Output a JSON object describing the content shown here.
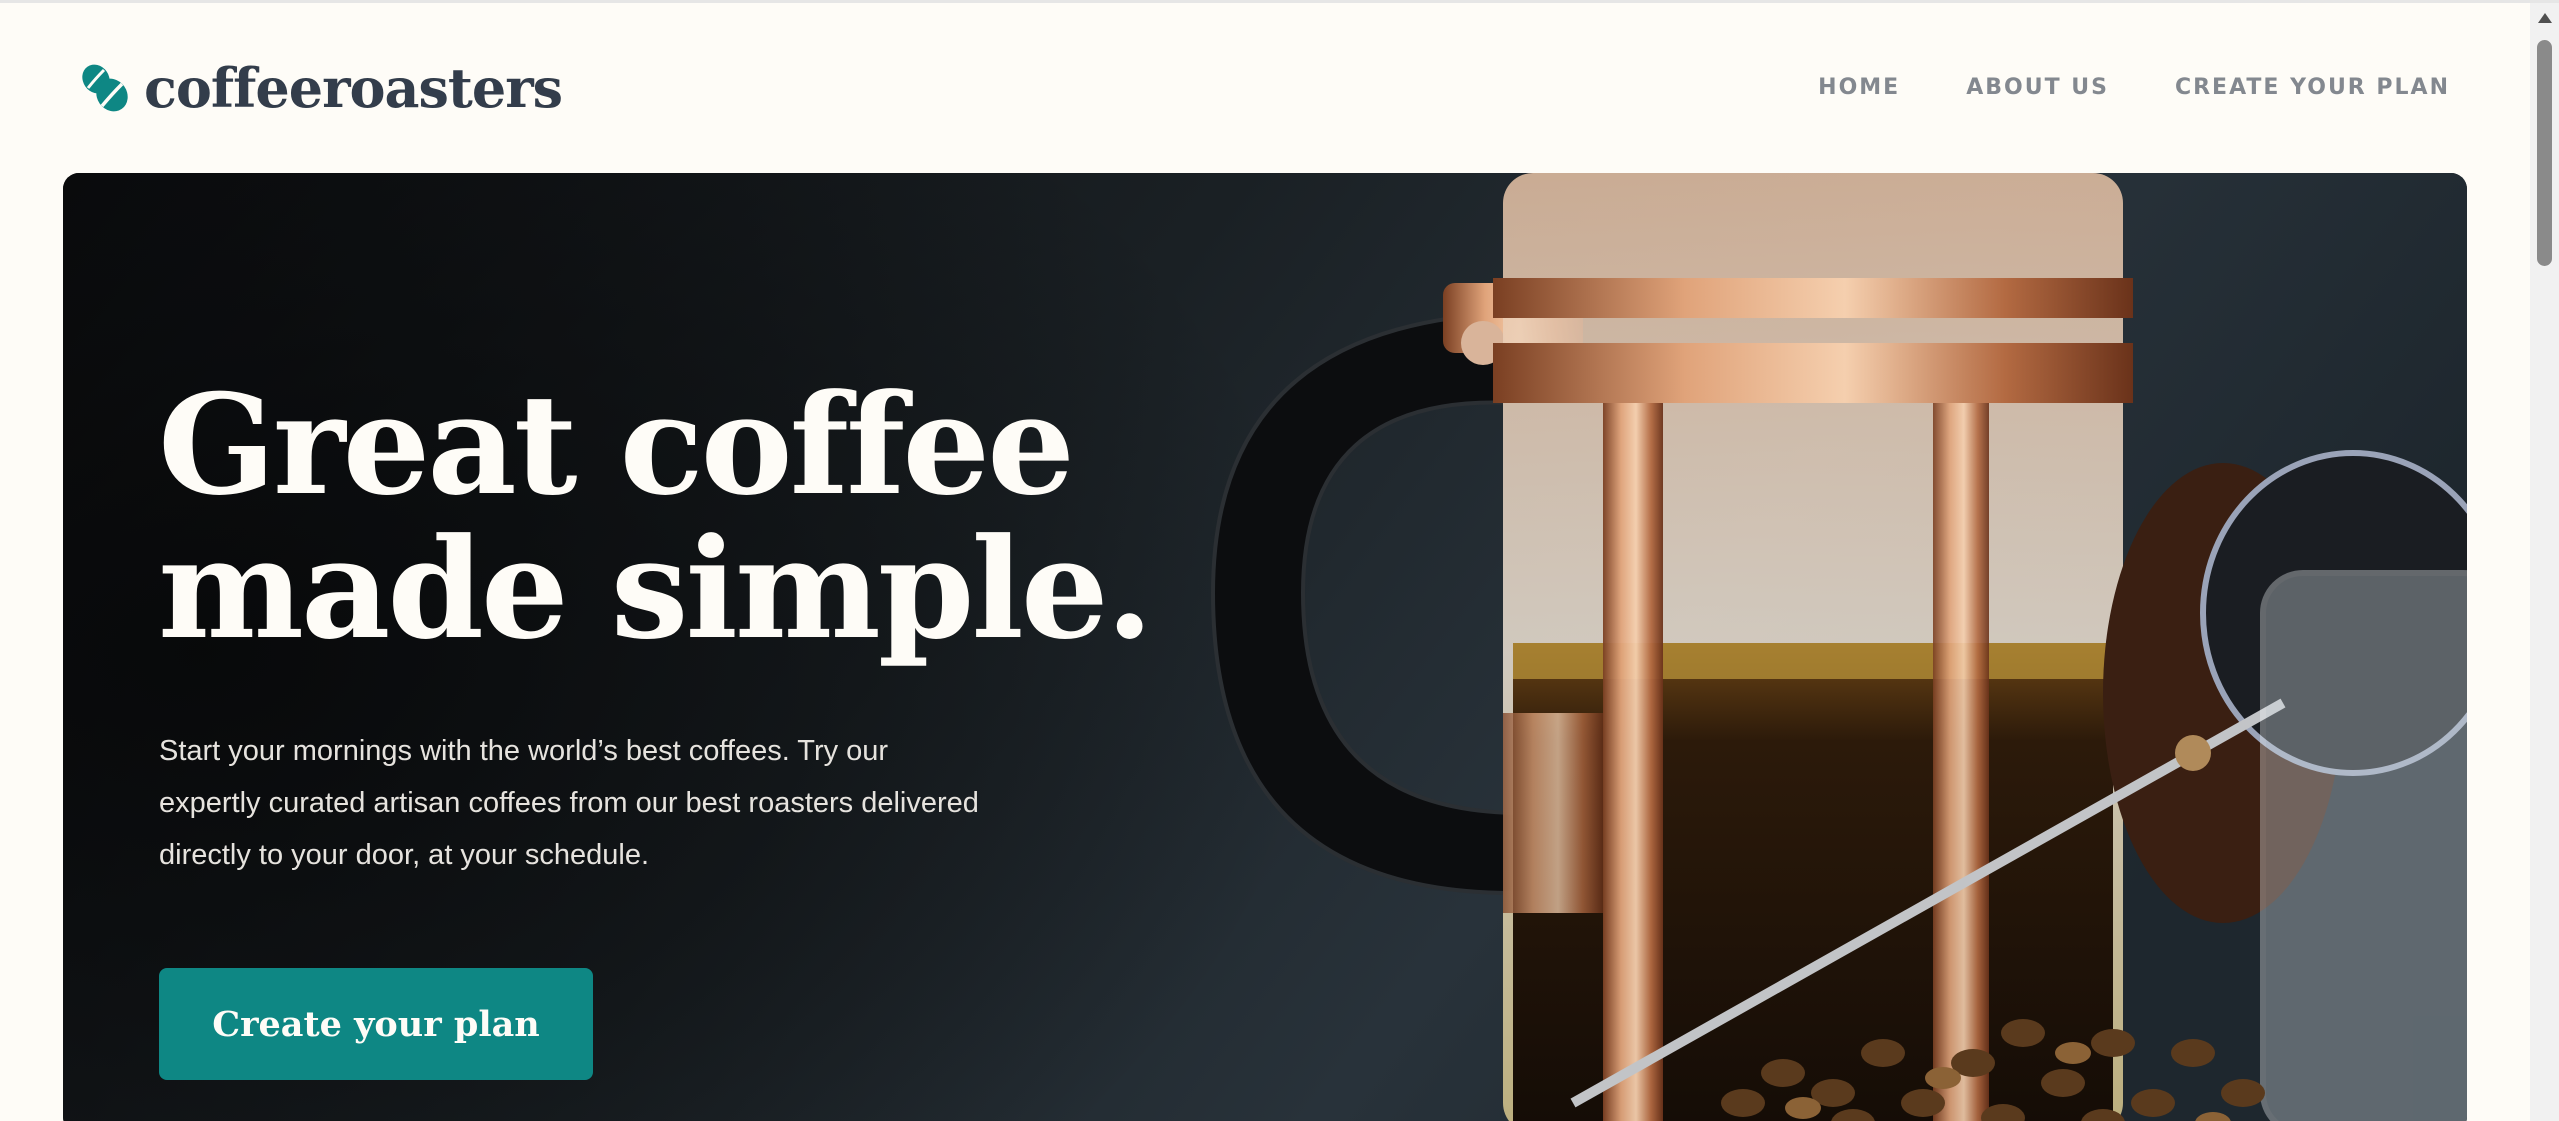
{
  "brand": {
    "name": "coffeeroasters",
    "color": "#333d4b",
    "accent": "#0e8784"
  },
  "nav": {
    "items": [
      {
        "label": "HOME"
      },
      {
        "label": "ABOUT US"
      },
      {
        "label": "CREATE YOUR PLAN"
      }
    ]
  },
  "hero": {
    "title_line1": "Great coffee",
    "title_line2": "made simple.",
    "description": "Start your mornings with the world’s best coffees. Try our expertly curated artisan coffees from our best roasters delivered directly to your door, at your schedule.",
    "cta_label": "Create your plan"
  },
  "icons": {
    "logo": "coffee-bean-icon",
    "scroll_up": "chevron-up-icon"
  }
}
